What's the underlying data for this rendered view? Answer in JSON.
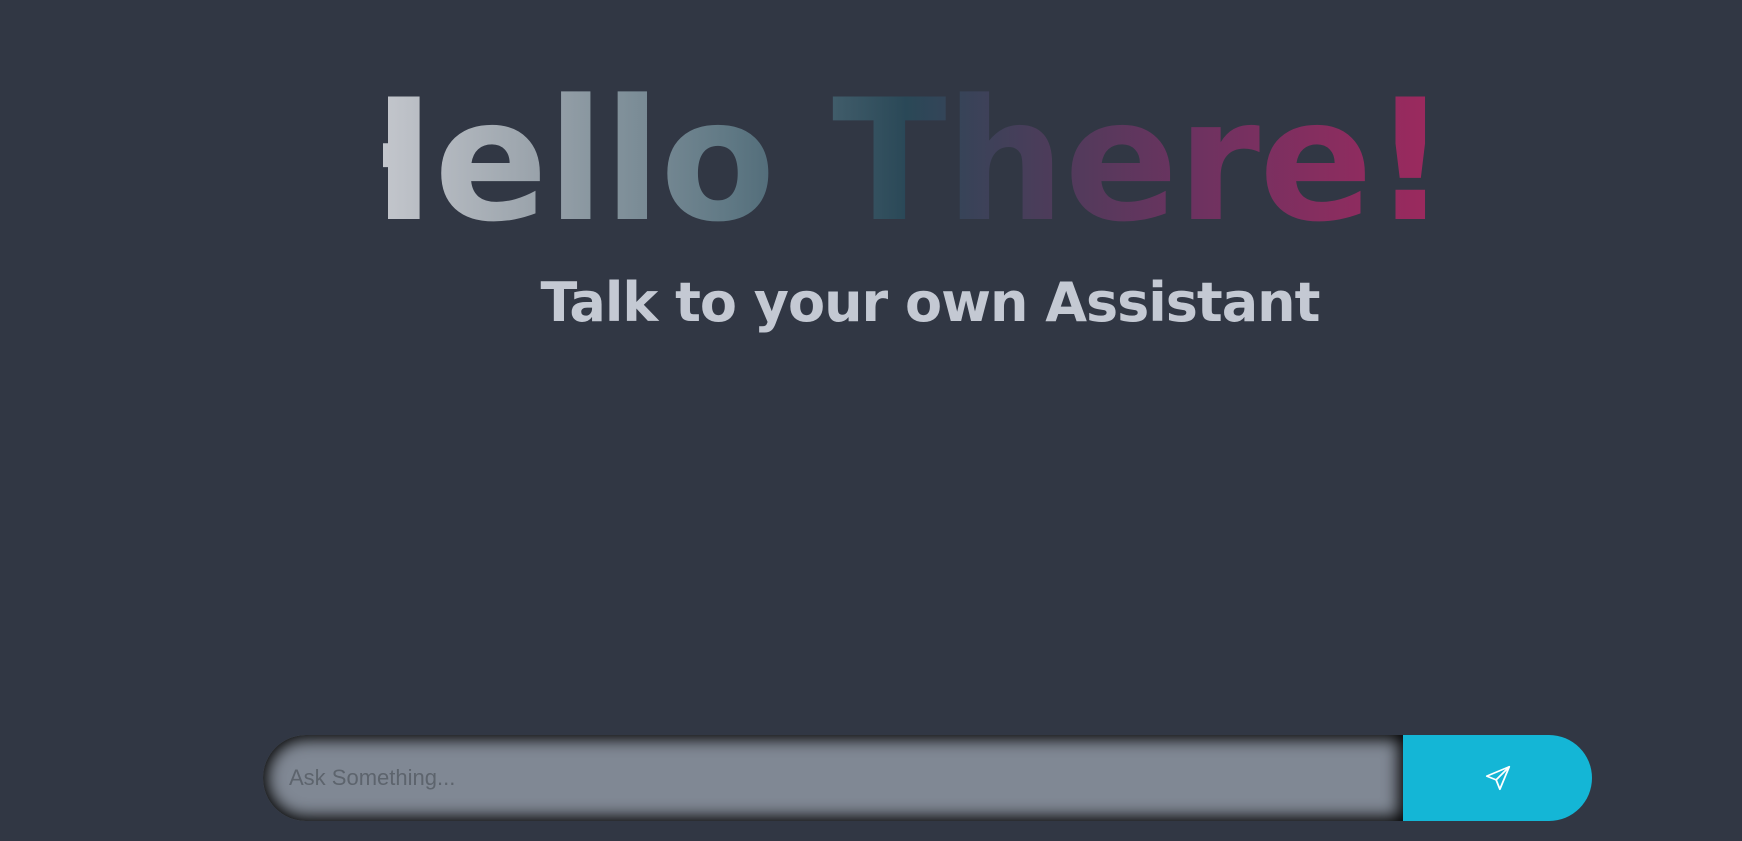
{
  "hero": {
    "title": "Hello There!",
    "subtitle": "Talk to your own Assistant",
    "gradient_colors": [
      "#c3c6cc",
      "#5f7884",
      "#2a4857",
      "#6e3260",
      "#a4285e"
    ]
  },
  "chat": {
    "placeholder": "Ask Something...",
    "value": "",
    "send_icon": "paper-plane-icon"
  },
  "colors": {
    "background": "#313744",
    "input_background": "#808894",
    "accent": "#14b6d6",
    "subtitle": "#c4c9d3"
  }
}
